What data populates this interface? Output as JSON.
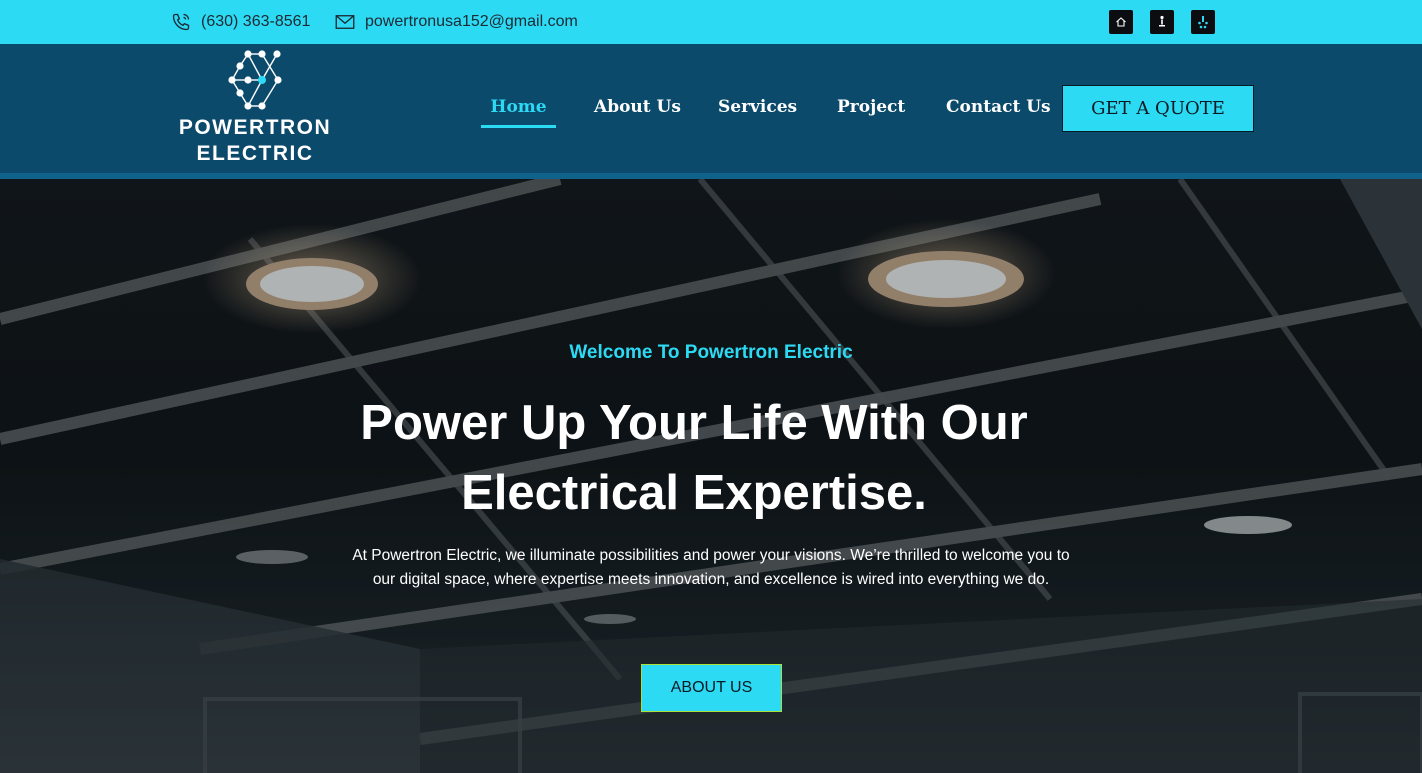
{
  "topbar": {
    "phone": "(630) 363-8561",
    "email": "powertronusa152@gmail.com",
    "social_icons": [
      "home-icon",
      "figure-icon",
      "yelp-icon"
    ]
  },
  "brand": {
    "line1": "POWERTRON",
    "line2": "ELECTRIC"
  },
  "nav": {
    "items": [
      {
        "label": "Home",
        "active": true
      },
      {
        "label": "About Us",
        "active": false
      },
      {
        "label": "Services",
        "active": false
      },
      {
        "label": "Project",
        "active": false
      },
      {
        "label": "Contact Us",
        "active": false
      }
    ],
    "cta": "GET A QUOTE"
  },
  "hero": {
    "eyebrow": "Welcome To Powertron Electric",
    "headline": "Power Up Your Life With Our Electrical Expertise.",
    "description": "At Powertron Electric, we illuminate possibilities and power your visions. We’re thrilled to welcome you to our digital space, where expertise meets innovation, and excellence is wired into everything we do.",
    "button": "ABOUT US"
  },
  "colors": {
    "accent": "#2ddaf4",
    "header_bg": "#0c4a6b",
    "button_border": "#a8e23a"
  }
}
